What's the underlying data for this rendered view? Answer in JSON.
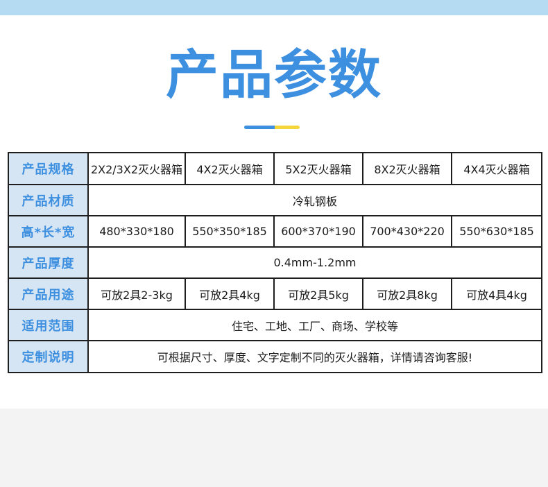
{
  "header": {
    "title": "产品参数"
  },
  "accent_colors": {
    "title_blue": "#3d8fe0",
    "underline_yellow": "#f5d63a",
    "top_band": "#b5dbf2",
    "label_cell_bg": "#d6e5f4"
  },
  "table": {
    "rows": [
      {
        "label": "产品规格",
        "cells": [
          "2X2/3X2灭火器箱",
          "4X2灭火器箱",
          "5X2灭火器箱",
          "8X2灭火器箱",
          "4X4灭火器箱"
        ]
      },
      {
        "label": "产品材质",
        "value": "冷轧钢板"
      },
      {
        "label": "高*长*宽",
        "cells": [
          "480*330*180",
          "550*350*185",
          "600*370*190",
          "700*430*220",
          "550*630*185"
        ]
      },
      {
        "label": "产品厚度",
        "value": "0.4mm-1.2mm"
      },
      {
        "label": "产品用途",
        "cells": [
          "可放2具2-3kg",
          "可放2具4kg",
          "可放2具5kg",
          "可放2具8kg",
          "可放4具4kg"
        ]
      },
      {
        "label": "适用范围",
        "value": "住宅、工地、工厂、商场、学校等"
      },
      {
        "label": "定制说明",
        "value": "可根据尺寸、厚度、文字定制不同的灭火器箱，详情请咨询客服!"
      }
    ]
  }
}
